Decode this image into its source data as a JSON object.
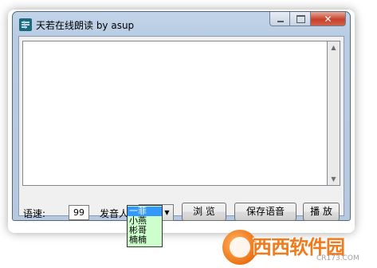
{
  "window": {
    "title": "天若在线朗读 by asup",
    "minimize_glyph": "",
    "close_glyph": "✕"
  },
  "editor": {
    "text": ""
  },
  "controls": {
    "speed_label": "语速:",
    "speed_value": "99",
    "voice_label": "发音人:",
    "voice_selected": "一菲",
    "browse_label": "浏 览",
    "save_label": "保存语音",
    "play_label": "播 放"
  },
  "voice_options": [
    "一菲",
    "小燕",
    "彬哥",
    "楠楠"
  ],
  "watermark": {
    "brand": "西西软件园",
    "url": "CR173.COM"
  },
  "colors": {
    "dropdown_bg": "#ccffcc",
    "selection": "#3399ff",
    "watermark": "#f07a1c"
  }
}
